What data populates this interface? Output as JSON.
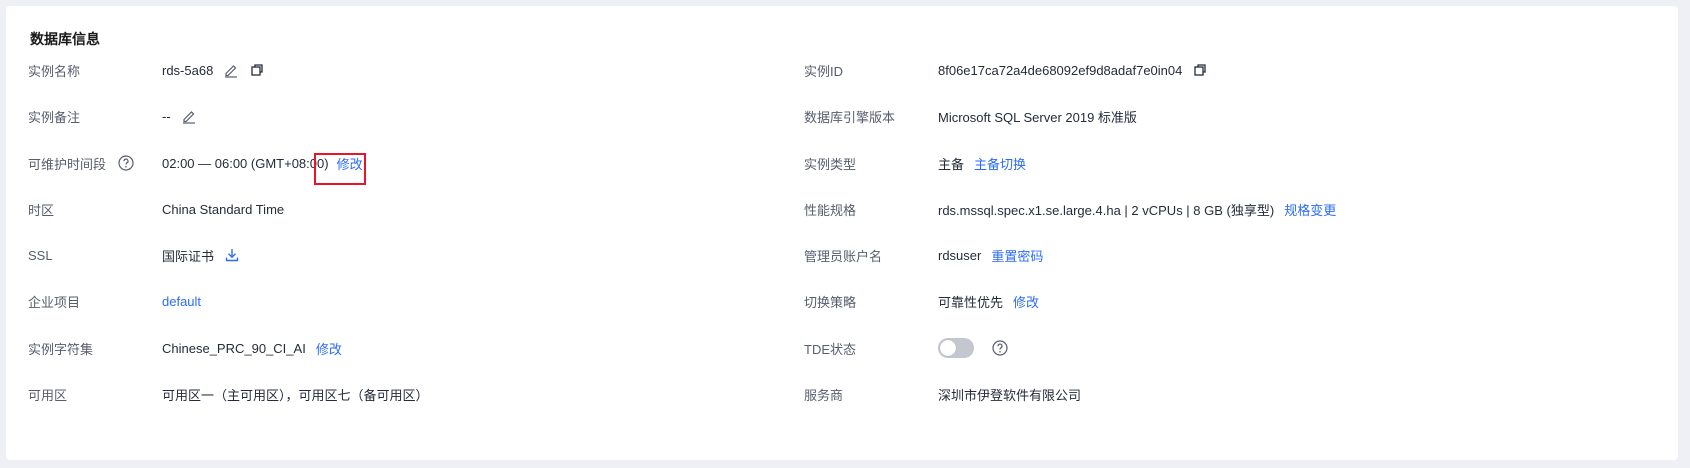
{
  "section_title": "数据库信息",
  "left": {
    "instance_name": {
      "label": "实例名称",
      "value": "rds-5a68"
    },
    "instance_remark": {
      "label": "实例备注",
      "value": "--"
    },
    "maintenance_window": {
      "label": "可维护时间段",
      "value": "02:00 — 06:00 (GMT+08:00)",
      "action": "修改"
    },
    "timezone": {
      "label": "时区",
      "value": "China Standard Time"
    },
    "ssl": {
      "label": "SSL",
      "value": "国际证书"
    },
    "enterprise_project": {
      "label": "企业项目",
      "value": "default"
    },
    "charset": {
      "label": "实例字符集",
      "value": "Chinese_PRC_90_CI_AI",
      "action": "修改"
    },
    "az": {
      "label": "可用区",
      "value": "可用区一（主可用区），可用区七（备可用区）"
    }
  },
  "right": {
    "instance_id": {
      "label": "实例ID",
      "value": "8f06e17ca72a4de68092ef9d8adaf7e0in04"
    },
    "engine_version": {
      "label": "数据库引擎版本",
      "value": "Microsoft SQL Server 2019 标准版"
    },
    "instance_type": {
      "label": "实例类型",
      "value": "主备",
      "action": "主备切换"
    },
    "spec": {
      "label": "性能规格",
      "value": "rds.mssql.spec.x1.se.large.4.ha | 2 vCPUs | 8 GB (独享型)",
      "action": "规格变更"
    },
    "admin_account": {
      "label": "管理员账户名",
      "value": "rdsuser",
      "action": "重置密码"
    },
    "switch_policy": {
      "label": "切换策略",
      "value": "可靠性优先",
      "action": "修改"
    },
    "tde": {
      "label": "TDE状态",
      "enabled": false
    },
    "provider": {
      "label": "服务商",
      "value": "深圳市伊登软件有限公司"
    }
  },
  "colors": {
    "link": "#2b6cf6",
    "highlight": "#e8142b"
  }
}
